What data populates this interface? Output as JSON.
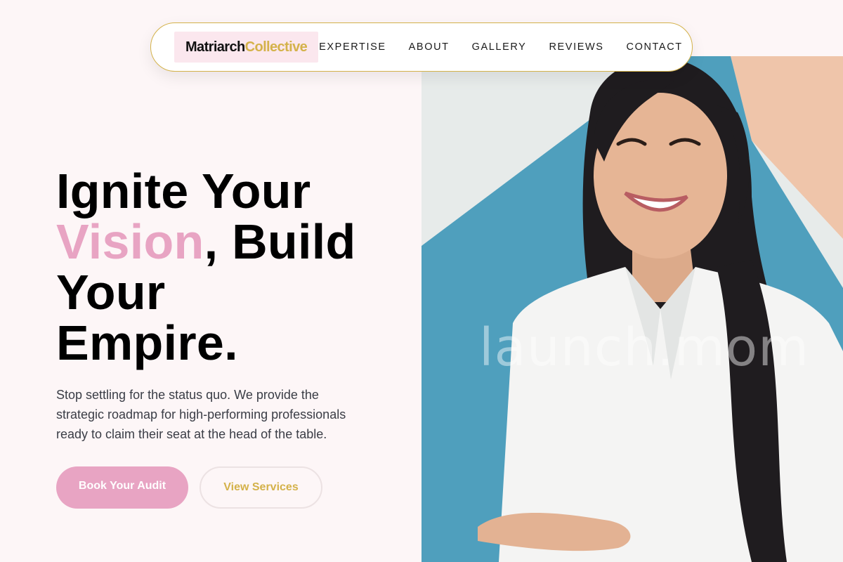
{
  "brand": {
    "logo_part1": "Matriarch",
    "logo_part2": "Collective",
    "accent_pink": "#e8a4c3",
    "accent_gold": "#d4b24a",
    "background": "#fdf6f7"
  },
  "nav": {
    "links": [
      "EXPERTISE",
      "ABOUT",
      "GALLERY",
      "REVIEWS",
      "CONTACT"
    ]
  },
  "hero": {
    "headline_line1": "Ignite Your",
    "headline_accent": "Vision",
    "headline_rest1": ", Build",
    "headline_line3": "Your",
    "headline_line4": "Empire.",
    "subtext": "Stop settling for the status quo. We provide the strategic roadmap for high-performing professionals ready to claim their seat at the head of the table.",
    "primary_button": "Book Your Audit",
    "secondary_button": "View Services",
    "watermark": "launch.mom"
  }
}
